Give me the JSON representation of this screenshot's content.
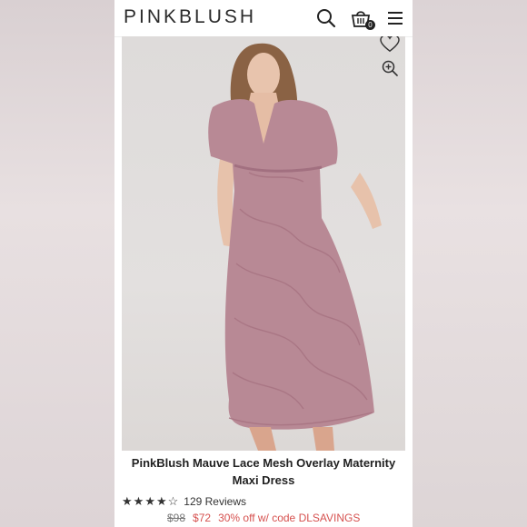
{
  "brand": {
    "logo_text": "PINKBLUSH"
  },
  "header": {
    "cart_count": "0"
  },
  "icons": {
    "search": "search-icon",
    "cart": "shopping-bag-icon",
    "menu": "hamburger-menu-icon",
    "favorite": "heart-icon",
    "zoom": "zoom-in-icon"
  },
  "product": {
    "title": "PinkBlush Mauve Lace Mesh Overlay Maternity Maxi Dress",
    "rating": 4.5,
    "reviews_label": "129 Reviews",
    "original_price": "$98",
    "sale_price": "$72",
    "promo": "30% off w/ code DLSAVINGS",
    "dress_color": "#b88995"
  }
}
